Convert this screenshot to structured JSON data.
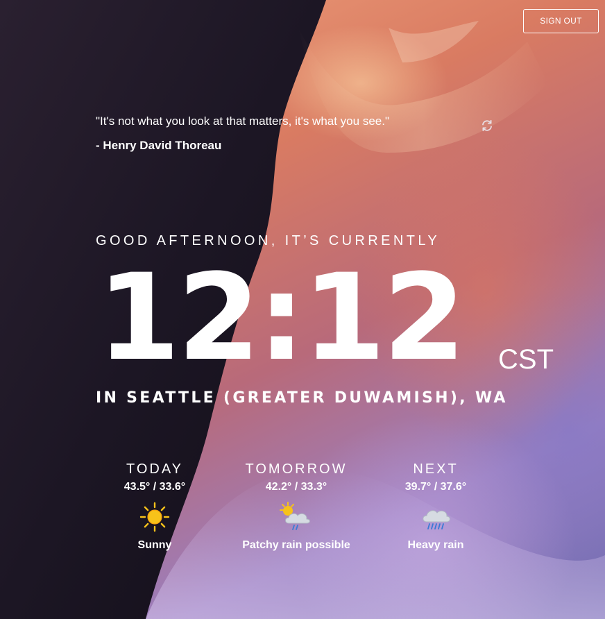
{
  "header": {
    "sign_out_label": "SIGN OUT"
  },
  "quote": {
    "text": "\"It's not what you look at that matters, it's what you see.\"",
    "author": "- Henry David Thoreau"
  },
  "clock": {
    "greeting": "GOOD AFTERNOON, IT’S CURRENTLY",
    "time": "12:12",
    "timezone": "CST",
    "location": "IN SEATTLE (GREATER DUWAMISH), WA"
  },
  "forecast": [
    {
      "label": "TODAY",
      "temp": "43.5° / 33.6°",
      "condition": "Sunny",
      "icon": "sun-icon"
    },
    {
      "label": "TOMORROW",
      "temp": "42.2° / 33.3°",
      "condition": "Patchy rain possible",
      "icon": "sun-cloud-rain-icon"
    },
    {
      "label": "NEXT",
      "temp": "39.7° / 37.6°",
      "condition": "Heavy rain",
      "icon": "cloud-heavy-rain-icon"
    }
  ],
  "colors": {
    "text": "#ffffff",
    "sun": "#f7c21a",
    "cloud": "#d6dbe2",
    "rain": "#3a7bd5",
    "canyon_dark": "#1c1624"
  }
}
